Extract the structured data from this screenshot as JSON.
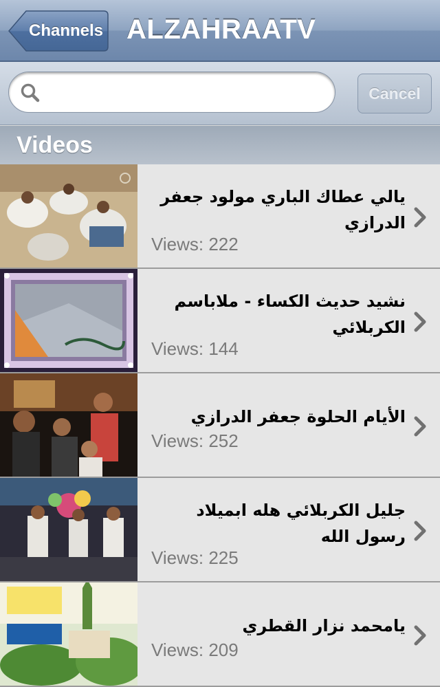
{
  "navbar": {
    "back_label": "Channels",
    "title": "ALZAHRAATV"
  },
  "search": {
    "value": "",
    "placeholder": "",
    "cancel_label": "Cancel"
  },
  "section": {
    "title": "Videos"
  },
  "videos": [
    {
      "title": "يالي عطاك الباري مولود   جعفر الدرازي",
      "views": "Views: 222",
      "thumb": "crowd-seated-men"
    },
    {
      "title": "نشيد حديث الكساء - ملاباسم الكربلائي",
      "views": "Views: 144",
      "thumb": "fatima-calligraphy-frame"
    },
    {
      "title": "الأيام الحلوة   جعفر الدرازي",
      "views": "Views: 252",
      "thumb": "performers-stage"
    },
    {
      "title": "جليل الكربلائي هله ابميلاد رسول الله",
      "views": "Views: 225",
      "thumb": "celebration-crowd"
    },
    {
      "title": "يامحمد  نزار القطري",
      "views": "Views: 209",
      "thumb": "mosque-garden"
    }
  ],
  "colors": {
    "navbar": "#7c94b5",
    "row_bg": "#e6e6e6",
    "views_text": "#7a7a7a"
  },
  "icons": {
    "search": "search-icon",
    "chevron": "chevron-right-icon",
    "back": "back-arrow-button"
  }
}
